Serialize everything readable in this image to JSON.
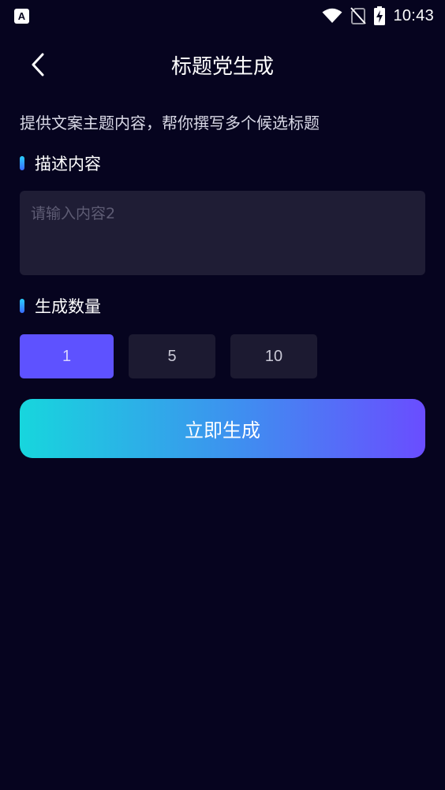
{
  "status_bar": {
    "app_icon_letter": "A",
    "time": "10:43"
  },
  "header": {
    "title": "标题党生成"
  },
  "intro": "提供文案主题内容，帮你撰写多个候选标题",
  "description": {
    "label": "描述内容",
    "placeholder": "请输入内容2",
    "value": ""
  },
  "count": {
    "label": "生成数量",
    "options": [
      "1",
      "5",
      "10"
    ],
    "selected": "1"
  },
  "generate_button": "立即生成",
  "colors": {
    "background": "#06041f",
    "accent": "#5e52ff",
    "gradient_start": "#17d6dd",
    "gradient_end": "#6a4dff"
  },
  "icons": {
    "back": "chevron-left-icon",
    "wifi": "wifi-icon",
    "signal": "no-sim-icon",
    "battery": "battery-charging-icon"
  }
}
